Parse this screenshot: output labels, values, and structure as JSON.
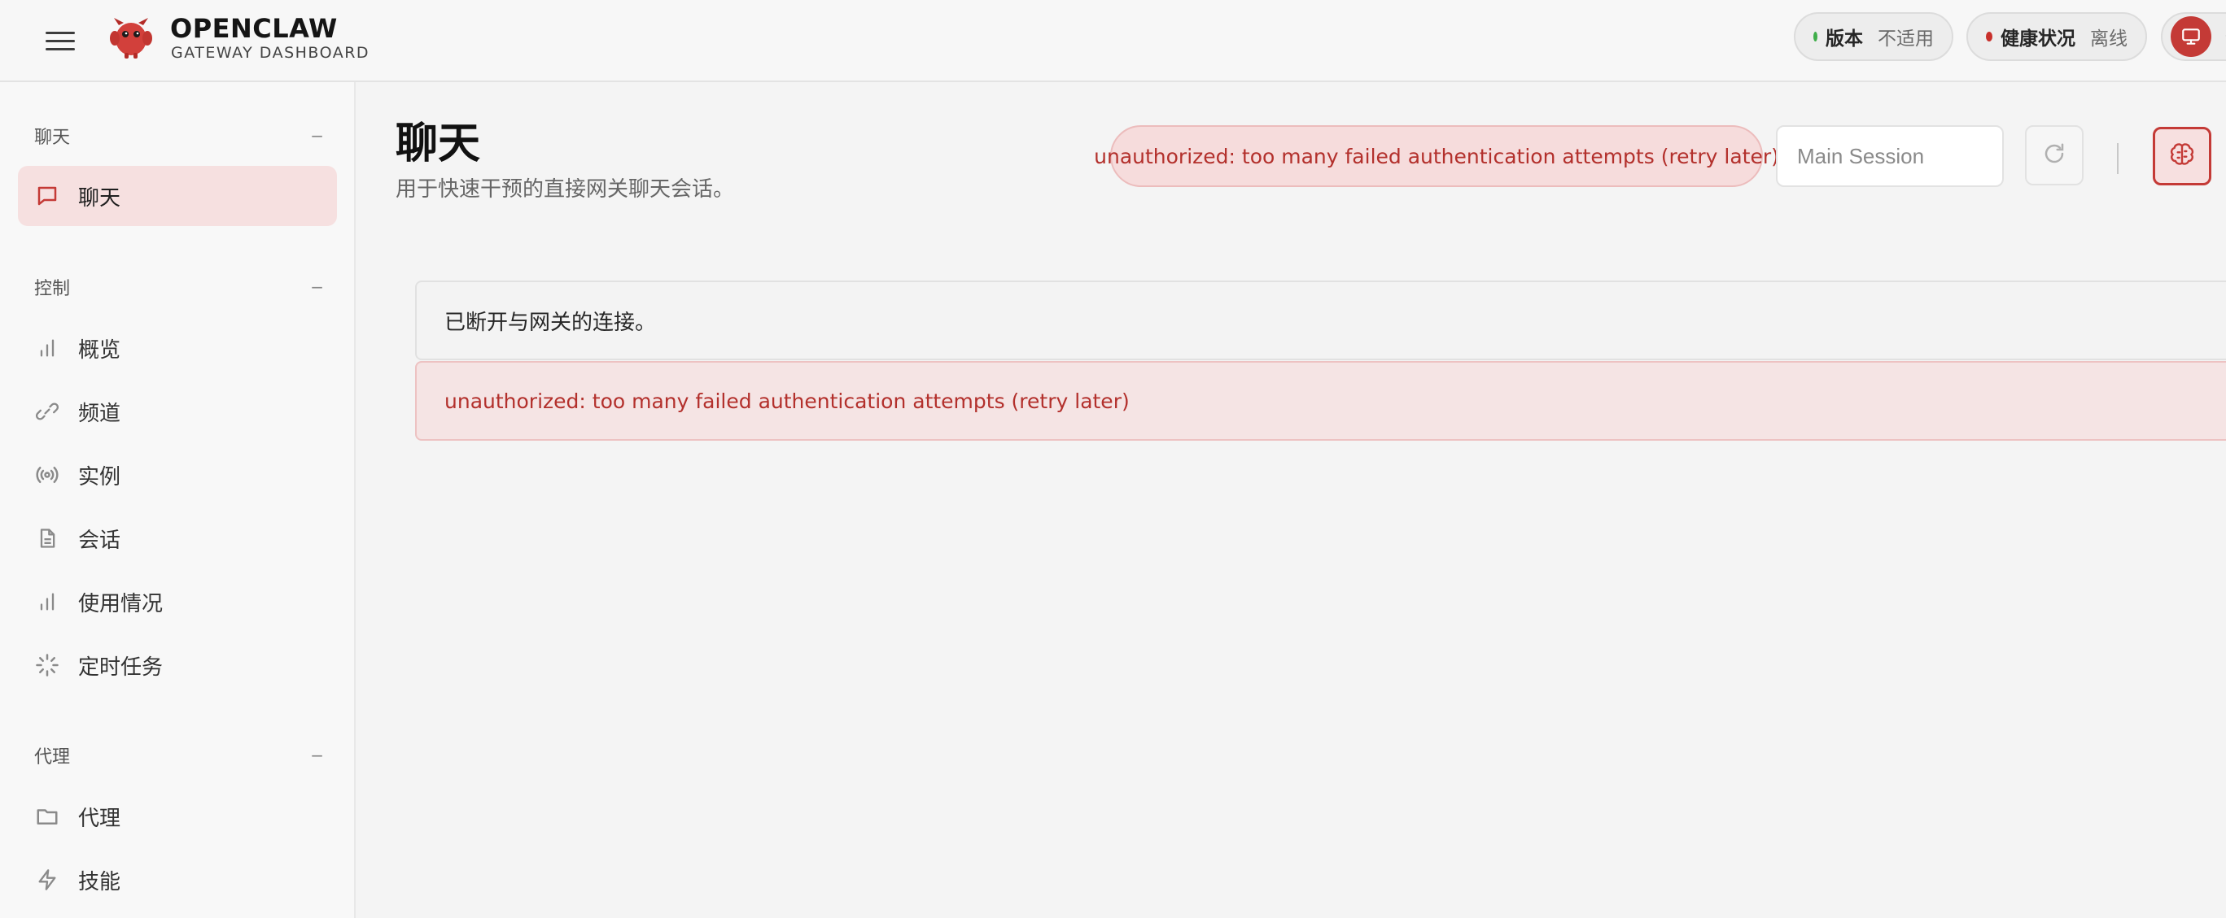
{
  "header": {
    "brand_title": "OPENCLAW",
    "brand_subtitle": "GATEWAY DASHBOARD",
    "version_label": "版本",
    "version_value": "不适用",
    "health_label": "健康状况",
    "health_value": "离线"
  },
  "colors": {
    "accent": "#c43a36",
    "status_ok": "#3fae4a",
    "status_offline": "#c8302b",
    "active_nav_bg": "#f6e0e0",
    "error_text": "#b3302c"
  },
  "sidebar": {
    "sections": [
      {
        "title": "聊天",
        "collapse": "−"
      },
      {
        "title": "控制",
        "collapse": "−"
      },
      {
        "title": "代理",
        "collapse": "−"
      }
    ],
    "items": [
      {
        "label": "聊天",
        "icon": "chat-bubble-icon",
        "active": true
      },
      {
        "label": "概览",
        "icon": "bar-chart-icon"
      },
      {
        "label": "频道",
        "icon": "link-icon"
      },
      {
        "label": "实例",
        "icon": "broadcast-icon"
      },
      {
        "label": "会话",
        "icon": "document-icon"
      },
      {
        "label": "使用情况",
        "icon": "bar-chart-icon"
      },
      {
        "label": "定时任务",
        "icon": "spinner-icon"
      },
      {
        "label": "代理",
        "icon": "folder-icon"
      },
      {
        "label": "技能",
        "icon": "lightning-icon"
      }
    ]
  },
  "main": {
    "title": "聊天",
    "subtitle": "用于快速干预的直接网关聊天会话。",
    "error_banner": "unauthorized: too many failed authentication attempts (retry later)",
    "session_placeholder": "Main Session",
    "messages": {
      "disconnected": "已断开与网关的连接。",
      "error": "unauthorized: too many failed authentication attempts (retry later)"
    }
  }
}
